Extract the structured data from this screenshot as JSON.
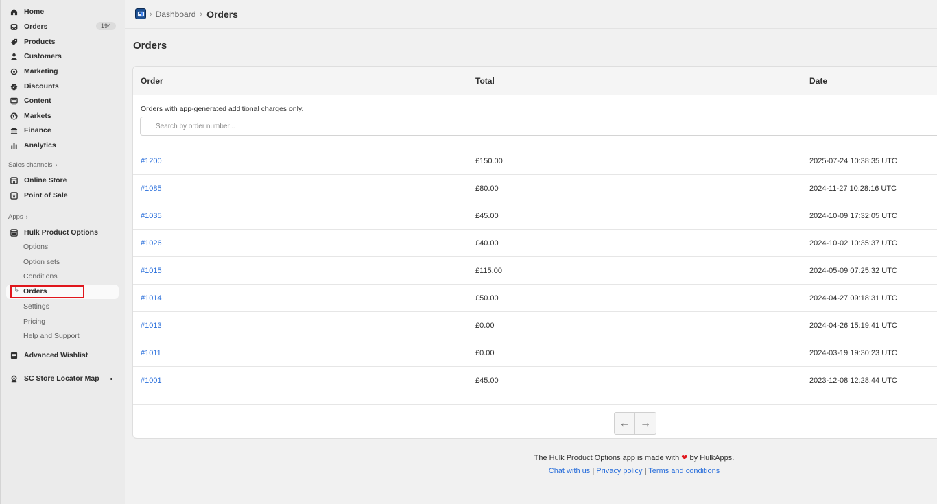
{
  "sidebar": {
    "items": [
      {
        "label": "Home",
        "icon": "home-icon"
      },
      {
        "label": "Orders",
        "icon": "orders-icon",
        "badge": "194"
      },
      {
        "label": "Products",
        "icon": "tag-icon"
      },
      {
        "label": "Customers",
        "icon": "person-icon"
      },
      {
        "label": "Marketing",
        "icon": "target-icon"
      },
      {
        "label": "Discounts",
        "icon": "discount-icon"
      },
      {
        "label": "Content",
        "icon": "content-icon"
      },
      {
        "label": "Markets",
        "icon": "globe-icon"
      },
      {
        "label": "Finance",
        "icon": "bank-icon"
      },
      {
        "label": "Analytics",
        "icon": "bar-chart-icon"
      }
    ],
    "sales_channels_label": "Sales channels",
    "channels": [
      {
        "label": "Online Store",
        "icon": "store-icon"
      },
      {
        "label": "Point of Sale",
        "icon": "pos-icon"
      }
    ],
    "apps_label": "Apps",
    "app_name": "Hulk Product Options",
    "app_subitems": [
      "Options",
      "Option sets",
      "Conditions"
    ],
    "active_subitem": "Orders",
    "app_subitems_after": [
      "Settings",
      "Pricing",
      "Help and Support"
    ],
    "other_apps": [
      {
        "label": "Advanced Wishlist",
        "icon": "wishlist-app-icon"
      },
      {
        "label": "SC Store Locator Map",
        "icon": "map-pin-app-icon"
      }
    ]
  },
  "breadcrumb": {
    "parent": "Dashboard",
    "current": "Orders"
  },
  "page_title": "Orders",
  "table": {
    "columns": [
      "Order",
      "Total",
      "Date"
    ],
    "note": "Orders with app-generated additional charges only.",
    "search_placeholder": "Search by order number...",
    "rows": [
      {
        "order": "#1200",
        "total": "£150.00",
        "date": "2025-07-24 10:38:35 UTC"
      },
      {
        "order": "#1085",
        "total": "£80.00",
        "date": "2024-11-27 10:28:16 UTC"
      },
      {
        "order": "#1035",
        "total": "£45.00",
        "date": "2024-10-09 17:32:05 UTC"
      },
      {
        "order": "#1026",
        "total": "£40.00",
        "date": "2024-10-02 10:35:37 UTC"
      },
      {
        "order": "#1015",
        "total": "£115.00",
        "date": "2024-05-09 07:25:32 UTC"
      },
      {
        "order": "#1014",
        "total": "£50.00",
        "date": "2024-04-27 09:18:31 UTC"
      },
      {
        "order": "#1013",
        "total": "£0.00",
        "date": "2024-04-26 15:19:41 UTC"
      },
      {
        "order": "#1011",
        "total": "£0.00",
        "date": "2024-03-19 19:30:23 UTC"
      },
      {
        "order": "#1001",
        "total": "£45.00",
        "date": "2023-12-08 12:28:44 UTC"
      }
    ]
  },
  "footer": {
    "made_with_prefix": "The Hulk Product Options app is made with",
    "made_with_suffix": "by HulkApps.",
    "links": [
      "Chat with us",
      "Privacy policy",
      "Terms and conditions"
    ],
    "separator": "|"
  },
  "colors": {
    "link": "#2a6fdb",
    "highlight": "#e0161c"
  }
}
